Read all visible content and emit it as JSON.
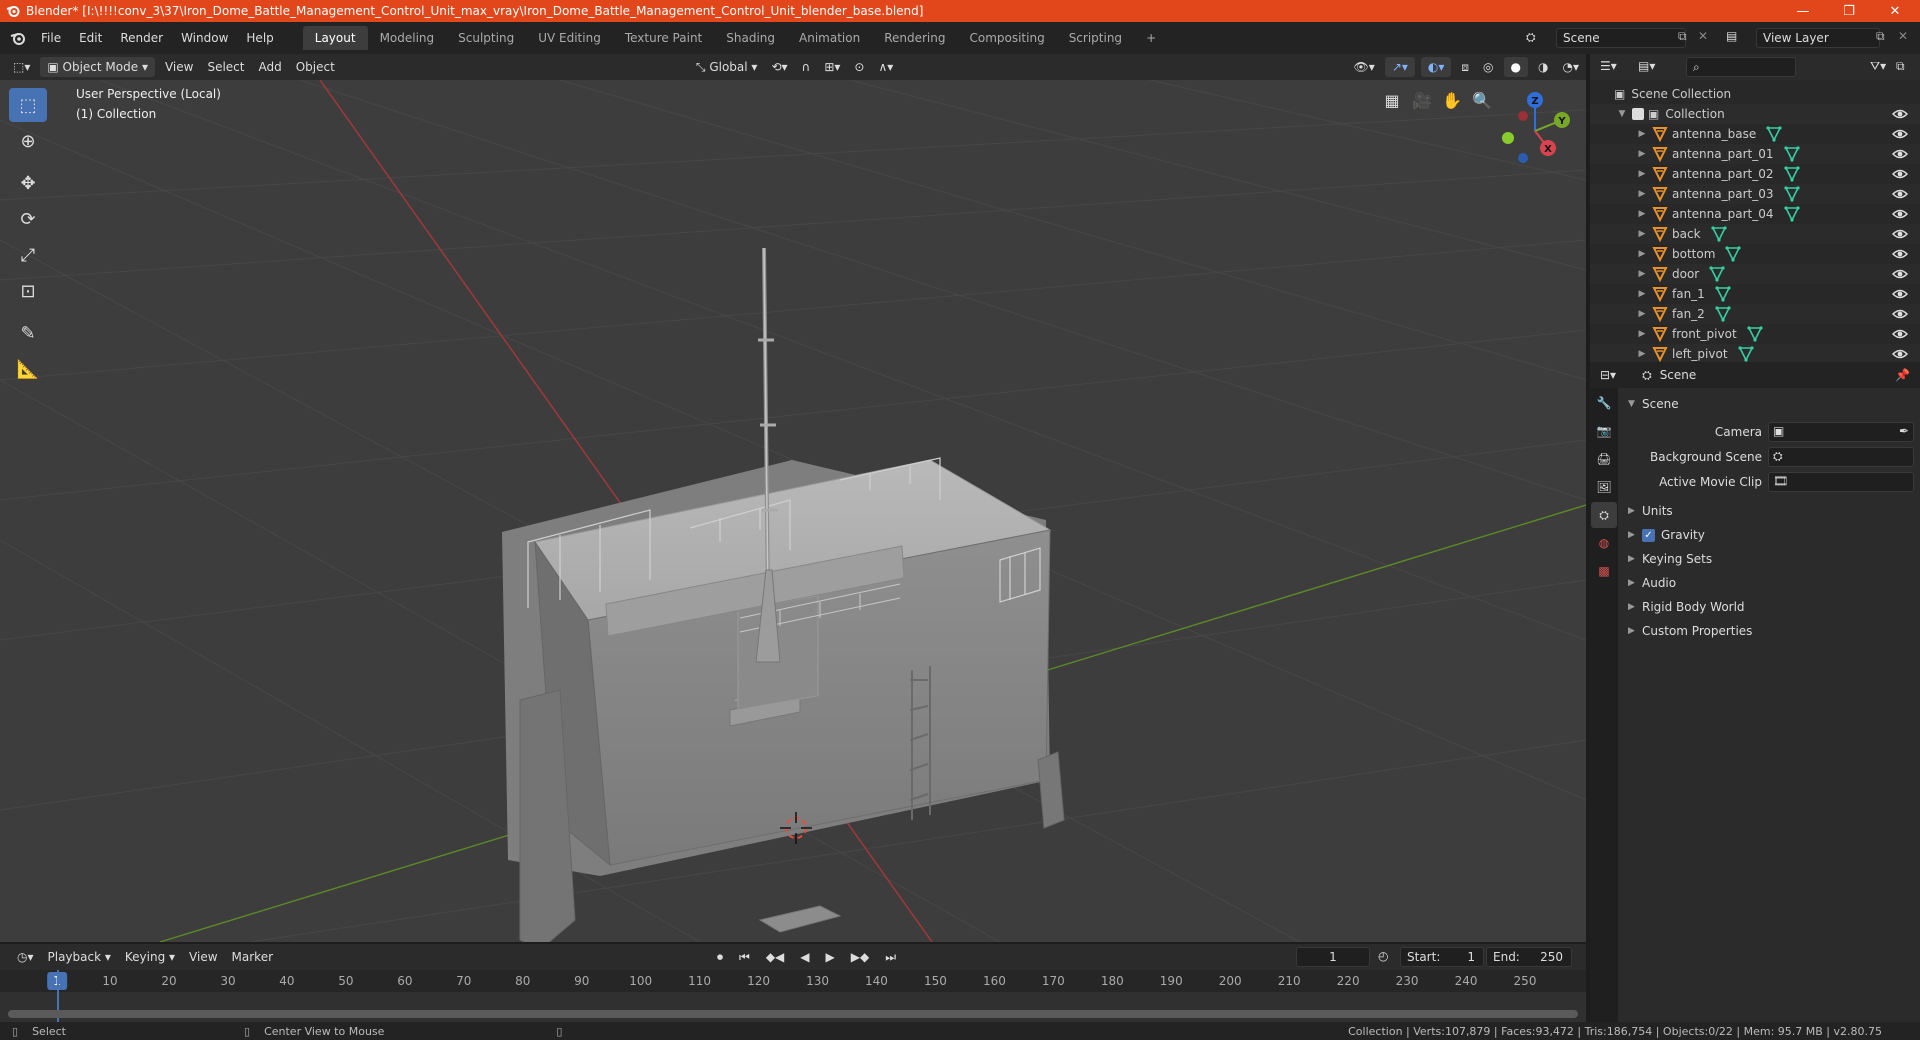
{
  "titlebar": {
    "title": "Blender* [I:\\!!!!conv_3\\37\\Iron_Dome_Battle_Management_Control_Unit_max_vray\\Iron_Dome_Battle_Management_Control_Unit_blender_base.blend]",
    "minimize": "—",
    "maximize": "❐",
    "close": "✕"
  },
  "menu": {
    "file": "File",
    "edit": "Edit",
    "render": "Render",
    "window": "Window",
    "help": "Help"
  },
  "workspaces": [
    "Layout",
    "Modeling",
    "Sculpting",
    "UV Editing",
    "Texture Paint",
    "Shading",
    "Animation",
    "Rendering",
    "Compositing",
    "Scripting"
  ],
  "add_workspace": "+",
  "scene_field": "Scene",
  "view_layer_field": "View Layer",
  "viewport_header": {
    "mode": "Object Mode",
    "view": "View",
    "select": "Select",
    "add": "Add",
    "object": "Object",
    "transform_orientation": "Global"
  },
  "viewport_info": {
    "line1": "User Perspective (Local)",
    "line2": "(1) Collection"
  },
  "gizmo": {
    "z": "Z",
    "y": "Y",
    "x": "X"
  },
  "outliner": {
    "scene_collection": "Scene Collection",
    "collection": "Collection",
    "items": [
      "antenna_base",
      "antenna_part_01",
      "antenna_part_02",
      "antenna_part_03",
      "antenna_part_04",
      "back",
      "bottom",
      "door",
      "fan_1",
      "fan_2",
      "front_pivot",
      "left_pivot"
    ]
  },
  "properties": {
    "header_title": "Scene",
    "section_scene": "Scene",
    "camera_label": "Camera",
    "background_scene_label": "Background Scene",
    "active_movie_clip_label": "Active Movie Clip",
    "units": "Units",
    "gravity": "Gravity",
    "keying_sets": "Keying Sets",
    "audio": "Audio",
    "rigid_body_world": "Rigid Body World",
    "custom_properties": "Custom Properties"
  },
  "timeline": {
    "playback": "Playback",
    "keying": "Keying",
    "view": "View",
    "marker": "Marker",
    "current_frame": "1",
    "start_label": "Start:",
    "start": "1",
    "end_label": "End:",
    "end": "250",
    "ruler": [
      "1",
      "10",
      "20",
      "30",
      "40",
      "50",
      "60",
      "70",
      "80",
      "90",
      "100",
      "110",
      "120",
      "130",
      "140",
      "150",
      "160",
      "170",
      "180",
      "190",
      "200",
      "210",
      "220",
      "230",
      "240",
      "250"
    ]
  },
  "statusbar": {
    "select": "Select",
    "center_view": "Center View to Mouse",
    "stats": "Collection | Verts:107,879 | Faces:93,472 | Tris:186,754 | Objects:0/22 | Mem: 95.7 MB | v2.80.75"
  },
  "colors": {
    "title_bar": "#e2461b",
    "accent": "#4772b3",
    "viewport_bg": "#3d3d3d",
    "x_axis": "#c0393b",
    "y_axis": "#6d9a29",
    "mesh_icon": "#e8902a"
  }
}
